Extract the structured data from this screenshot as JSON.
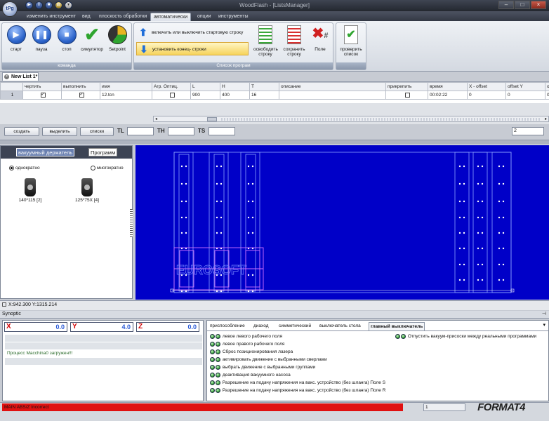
{
  "window": {
    "title": "WoodFlash - [ListsManager]",
    "logo_text": "tPg"
  },
  "menu_tabs": [
    "изменить инструмент",
    "вид",
    "плоскость обработки",
    "автоматически",
    "опции",
    "инструменты"
  ],
  "active_menu_tab": "автоматически",
  "ribbon": {
    "command_group": {
      "label": "команда",
      "buttons": [
        "старт",
        "пауза",
        "стоп",
        "симулятор",
        "Setpoint"
      ]
    },
    "program_list_group": {
      "label": "Список програм",
      "row_buttons": [
        "включить или выключить стартовую строку",
        "установить конец- строки"
      ],
      "buttons": [
        "освободить строку",
        "сохранить строку",
        "Поле"
      ]
    },
    "check_group": {
      "buttons": [
        "проверить список"
      ]
    }
  },
  "document_tab": "New List 1*",
  "grid": {
    "columns": [
      "",
      "чертить",
      "выполнить",
      "имя",
      "Агр. Оптиц.",
      "L",
      "H",
      "T",
      "описание",
      "прикрепить",
      "время",
      "X - offset",
      "offset Y",
      "o"
    ],
    "rows": [
      {
        "num": "1",
        "draw": true,
        "execute": true,
        "name": "12.tcn",
        "aggr": false,
        "L": "900",
        "H": "400",
        "T": "16",
        "desc": "",
        "attach": false,
        "time": "00:02:22",
        "x_offset": "0",
        "y_offset": "0",
        "o": "0"
      }
    ]
  },
  "controls": {
    "create_label": "создать",
    "choose_label": "выделить",
    "lists_label": "списки",
    "tl_label": "TL",
    "th_label": "TH",
    "ts_label": "TS",
    "spinner_value": "2"
  },
  "left_panel": {
    "tabs": [
      "вакуумный держатель",
      "Программ"
    ],
    "radio_single": "однократно",
    "radio_multi": "многократно",
    "tools": [
      "140*115 [2]",
      "125*75X [4]"
    ]
  },
  "canvas": {
    "watermark": "EUROSOFT",
    "bg_color": "#0000c8"
  },
  "status_line": "X:942.300 Y:1315.214",
  "synoptic": {
    "header": "Synoptic",
    "coords": {
      "x_label": "X",
      "x_value": "0.0",
      "y_label": "Y",
      "y_value": "4.0",
      "z_label": "Z",
      "z_value": "0.0"
    },
    "message": "Процесс Macchina0 загружен!!!",
    "tabs": [
      "приспособление",
      "диаход",
      "симметический",
      "выключатель стола",
      "главный выключатель"
    ],
    "active_tab": "главный выключатель",
    "signals_left": [
      "левое левого рабочего поля",
      "левое правого рабочего поля",
      "Сброс позиционирования лазера",
      "активировать движение с выбранными сверлами",
      "выбрать движение с выбранными группами",
      "деактивация вакуумного насоса",
      "Разрешение на подачу напряжения на вакс. устройство (без шланга) Поле S",
      "Разрешение на подачу напряжения на вакс. устройство (без шланга) Поле R"
    ],
    "signals_right": [
      "Отпустить вакуум-присоски между реальными программами"
    ]
  },
  "bottom": {
    "error_text": "MAIN ABS/Z Incorrect",
    "count": "1",
    "brand": "FORMAT4"
  }
}
